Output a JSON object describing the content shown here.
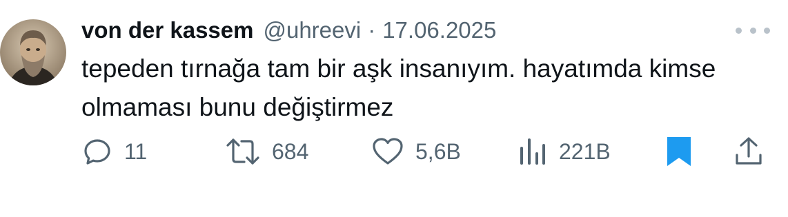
{
  "tweet": {
    "author_name": "von der kassem",
    "handle": "@uhreevi",
    "separator": "·",
    "date": "17.06.2025",
    "text_line1": "tepeden tırnağa tam bir aşk insanıyım. hayatımda kimse",
    "text_line2": "olmaması bunu değiştirmez"
  },
  "actions": {
    "replies": "11",
    "retweets": "684",
    "likes": "5,6B",
    "views": "221B"
  },
  "icons": {
    "reply": "reply-icon",
    "retweet": "retweet-icon",
    "like": "heart-icon",
    "views": "views-icon",
    "bookmark": "bookmark-icon",
    "share": "share-icon",
    "more": "more-icon"
  },
  "colors": {
    "text": "#0f1419",
    "secondary": "#536471",
    "bookmark_accent": "#1d9bf0"
  }
}
